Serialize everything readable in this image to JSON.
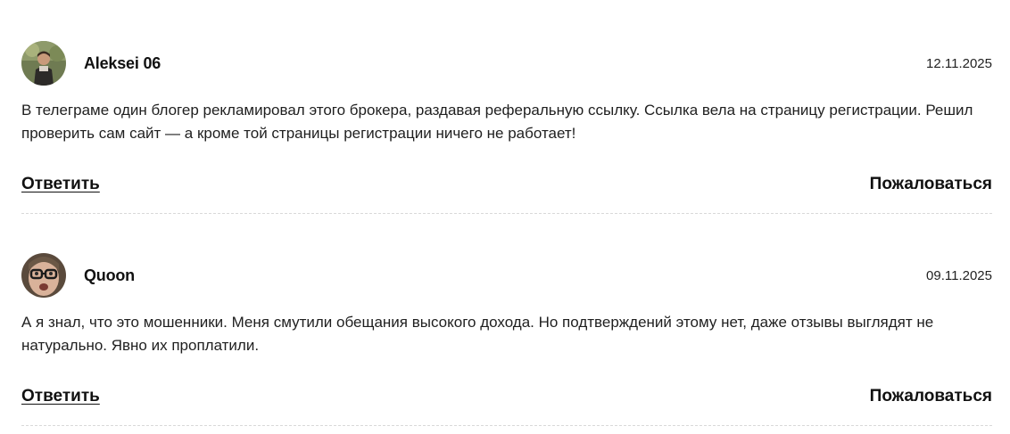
{
  "comments": [
    {
      "author": "Aleksei 06",
      "date": "12.11.2025",
      "text": "В телеграме один блогер рекламировал этого брокера, раздавая реферальную ссылку. Ссылка вела на страницу регистрации. Решил проверить сам сайт — а кроме той страницы регистрации ничего не работает!",
      "avatar_icon": "user-photo-avatar",
      "reply_label": "Ответить",
      "report_label": "Пожаловаться"
    },
    {
      "author": "Quoon",
      "date": "09.11.2025",
      "text": "А я знал, что это мошенники. Меня смутили обещания высокого дохода. Но подтверждений этому нет, даже отзывы выглядят не натурально. Явно их проплатили.",
      "avatar_icon": "user-photo-avatar",
      "reply_label": "Ответить",
      "report_label": "Пожаловаться"
    }
  ]
}
